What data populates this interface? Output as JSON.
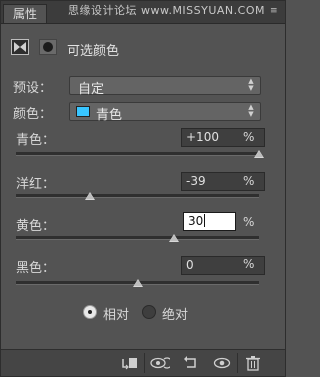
{
  "panel": {
    "tab_label": "属性",
    "watermark": "思缘设计论坛 www.MISSYUAN.COM",
    "title": "可选颜色"
  },
  "preset": {
    "label": "预设：",
    "value": "自定"
  },
  "colors": {
    "label": "颜色：",
    "value": "青色",
    "swatch": "#38c5ff"
  },
  "sliders": [
    {
      "label": "青色：",
      "value": "+100",
      "unit": "%",
      "level": 1.0
    },
    {
      "label": "洋红：",
      "value": "-39",
      "unit": "%",
      "level": 0.305
    },
    {
      "label": "黄色：",
      "value": "30",
      "unit": "%",
      "level": 0.65
    },
    {
      "label": "黑色：",
      "value": "0",
      "unit": "%",
      "level": 0.5
    }
  ],
  "method": {
    "options": [
      "相对",
      "绝对"
    ],
    "selected": "相对"
  },
  "footer_icons": [
    "clip-to-layer-icon",
    "eye-visibility-icon",
    "reset-icon",
    "view-previous-icon",
    "delete-icon"
  ]
}
